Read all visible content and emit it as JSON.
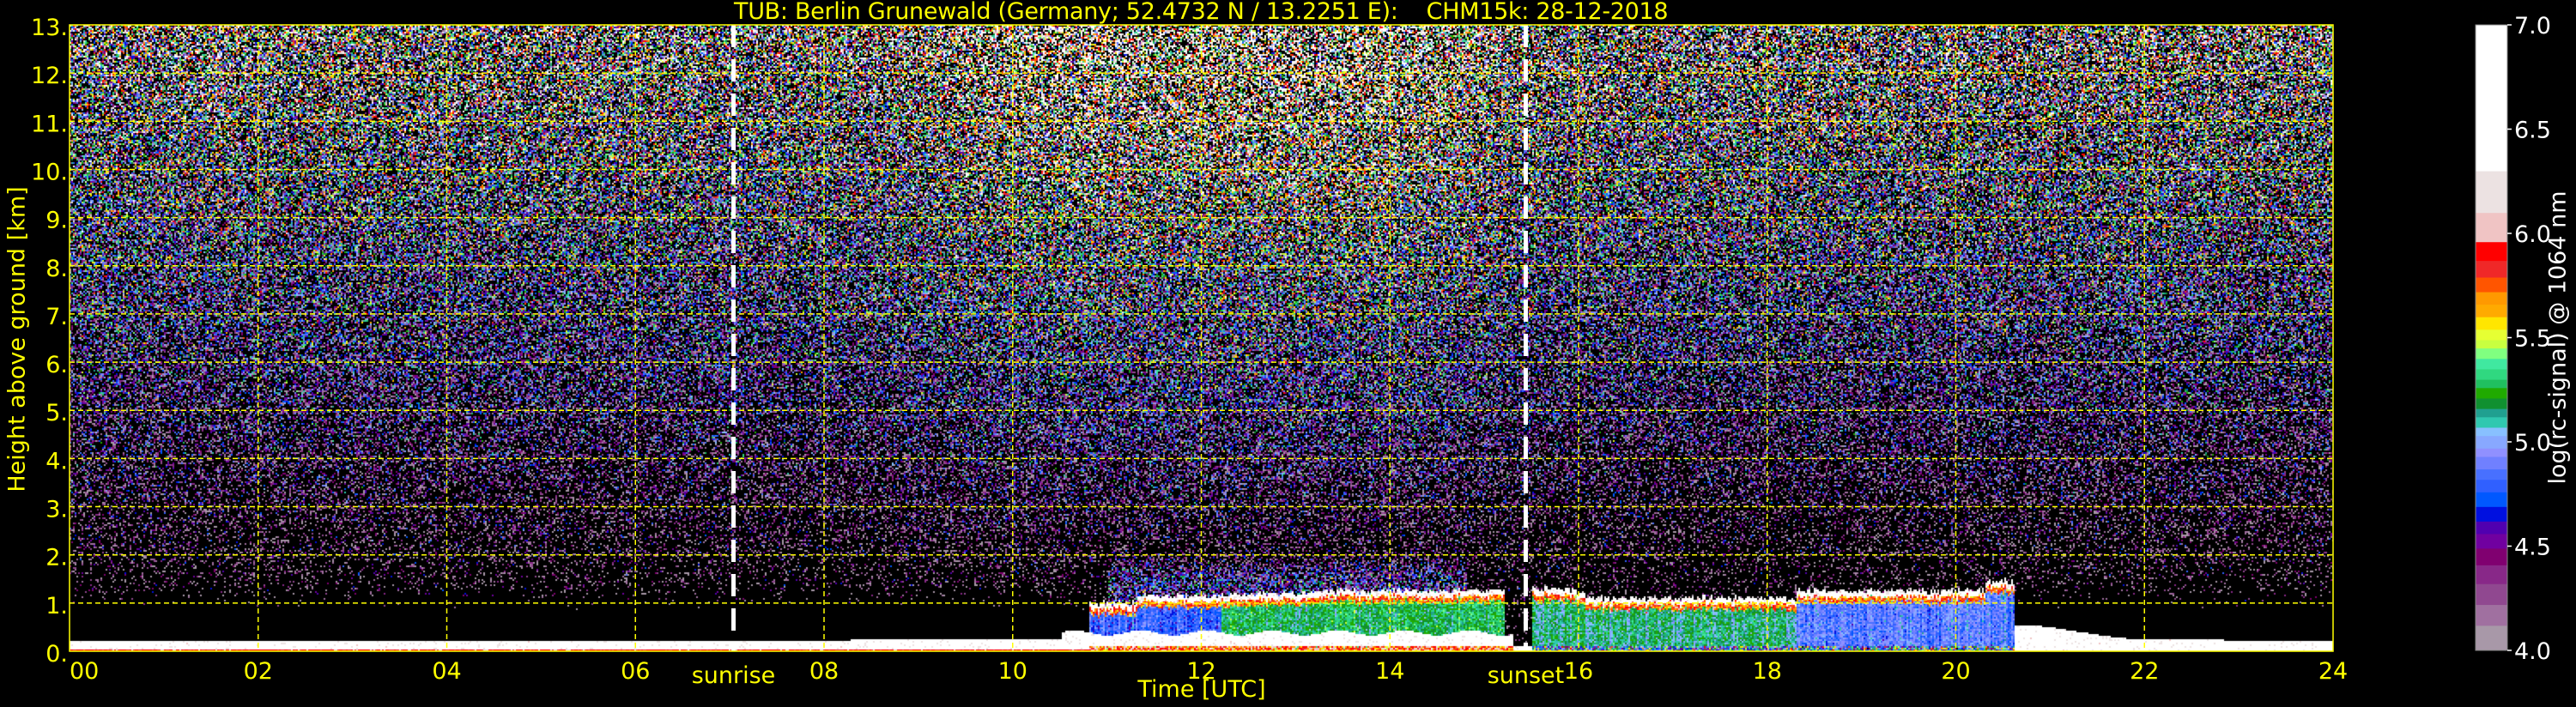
{
  "chart_data": {
    "type": "heatmap",
    "title": "TUB: Berlin Grunewald (Germany; 52.4732 N / 13.2251 E):    CHM15k: 28-12-2018",
    "xlabel": "Time [UTC]",
    "ylabel": "Height above ground [km]",
    "xlim": [
      0,
      24
    ],
    "ylim": [
      0,
      13
    ],
    "xticks": [
      "00",
      "02",
      "04",
      "06",
      "08",
      "10",
      "12",
      "14",
      "16",
      "18",
      "20",
      "22",
      "24"
    ],
    "xtick_values": [
      0,
      2,
      4,
      6,
      8,
      10,
      12,
      14,
      16,
      18,
      20,
      22,
      24
    ],
    "yticks": [
      "0.",
      "1.",
      "2.",
      "3.",
      "4.",
      "5.",
      "6.",
      "7.",
      "8.",
      "9.",
      "10.",
      "11.",
      "12.",
      "13."
    ],
    "ytick_values": [
      0,
      1,
      2,
      3,
      4,
      5,
      6,
      7,
      8,
      9,
      10,
      11,
      12,
      13
    ],
    "grid": true,
    "grid_color": "#ffff00",
    "background": "#000000",
    "annotations": [
      {
        "label": "sunrise",
        "time": 7.04,
        "line_color": "#ffffff"
      },
      {
        "label": "sunset",
        "time": 15.44,
        "line_color": "#ffffff"
      }
    ],
    "colorbar": {
      "label": "log(rc-signal) @ 1064 nm",
      "range": [
        4.0,
        7.0
      ],
      "ticks": [
        "4.0",
        "4.5",
        "5.0",
        "5.5",
        "6.0",
        "6.5",
        "7.0"
      ],
      "tick_values": [
        4.0,
        4.5,
        5.0,
        5.5,
        6.0,
        6.5,
        7.0
      ],
      "levels": [
        4.0,
        4.12,
        4.22,
        4.32,
        4.41,
        4.49,
        4.56,
        4.62,
        4.69,
        4.76,
        4.82,
        4.87,
        4.93,
        4.97,
        5.03,
        5.07,
        5.12,
        5.16,
        5.21,
        5.26,
        5.3,
        5.35,
        5.4,
        5.45,
        5.49,
        5.54,
        5.6,
        5.66,
        5.72,
        5.79,
        5.87,
        5.96,
        6.1,
        6.3,
        7.0
      ],
      "colors": [
        "#a898a8",
        "#a070a0",
        "#904890",
        "#882888",
        "#800070",
        "#7000a0",
        "#5000b0",
        "#0010e0",
        "#0058ff",
        "#3060ff",
        "#4870ff",
        "#7080ff",
        "#9090ff",
        "#88a8ff",
        "#88c0ff",
        "#30c8b0",
        "#20a090",
        "#109030",
        "#20aa00",
        "#20c060",
        "#30d880",
        "#40e8a0",
        "#80ff80",
        "#c8ff40",
        "#e6ff33",
        "#ffe600",
        "#ffaa00",
        "#ff9900",
        "#ff5500",
        "#f02828",
        "#ff0000",
        "#f0c4c4",
        "#ece2e2",
        "#ffffff"
      ]
    }
  }
}
